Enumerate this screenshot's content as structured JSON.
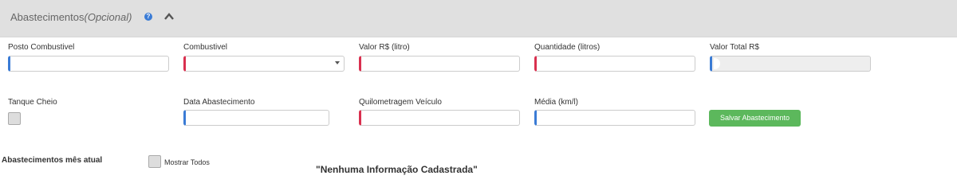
{
  "panel": {
    "title": "Abastecimentos",
    "title_optional": "(Opcional)",
    "help_icon": "question-circle-icon",
    "toggle_icon": "chevron-up-icon"
  },
  "form": {
    "posto_label": "Posto Combustivel",
    "posto_value": "",
    "combustivel_label": "Combustivel",
    "combustivel_selected": "",
    "valor_litro_label": "Valor R$ (litro)",
    "valor_litro_value": "",
    "quantidade_label": "Quantidade (litros)",
    "quantidade_value": "",
    "valor_total_label": "Valor Total R$",
    "valor_total_value": "",
    "tanque_label": "Tanque Cheio",
    "data_label": "Data Abastecimento",
    "data_value": "",
    "km_label": "Quilometragem Veículo",
    "km_value": "",
    "media_label": "Média (km/l)",
    "media_value": "",
    "save_label": "Salvar Abastecimento"
  },
  "list": {
    "section_label": "Abastecimentos mês atual",
    "show_all_label": "Mostrar Todos",
    "empty_message": "\"Nenhuma Informação Cadastrada\""
  },
  "colors": {
    "header_bg": "#e0e0e0",
    "required_accent": "#d9304f",
    "optional_accent": "#3a7bd5",
    "save_button": "#5cb85c"
  }
}
